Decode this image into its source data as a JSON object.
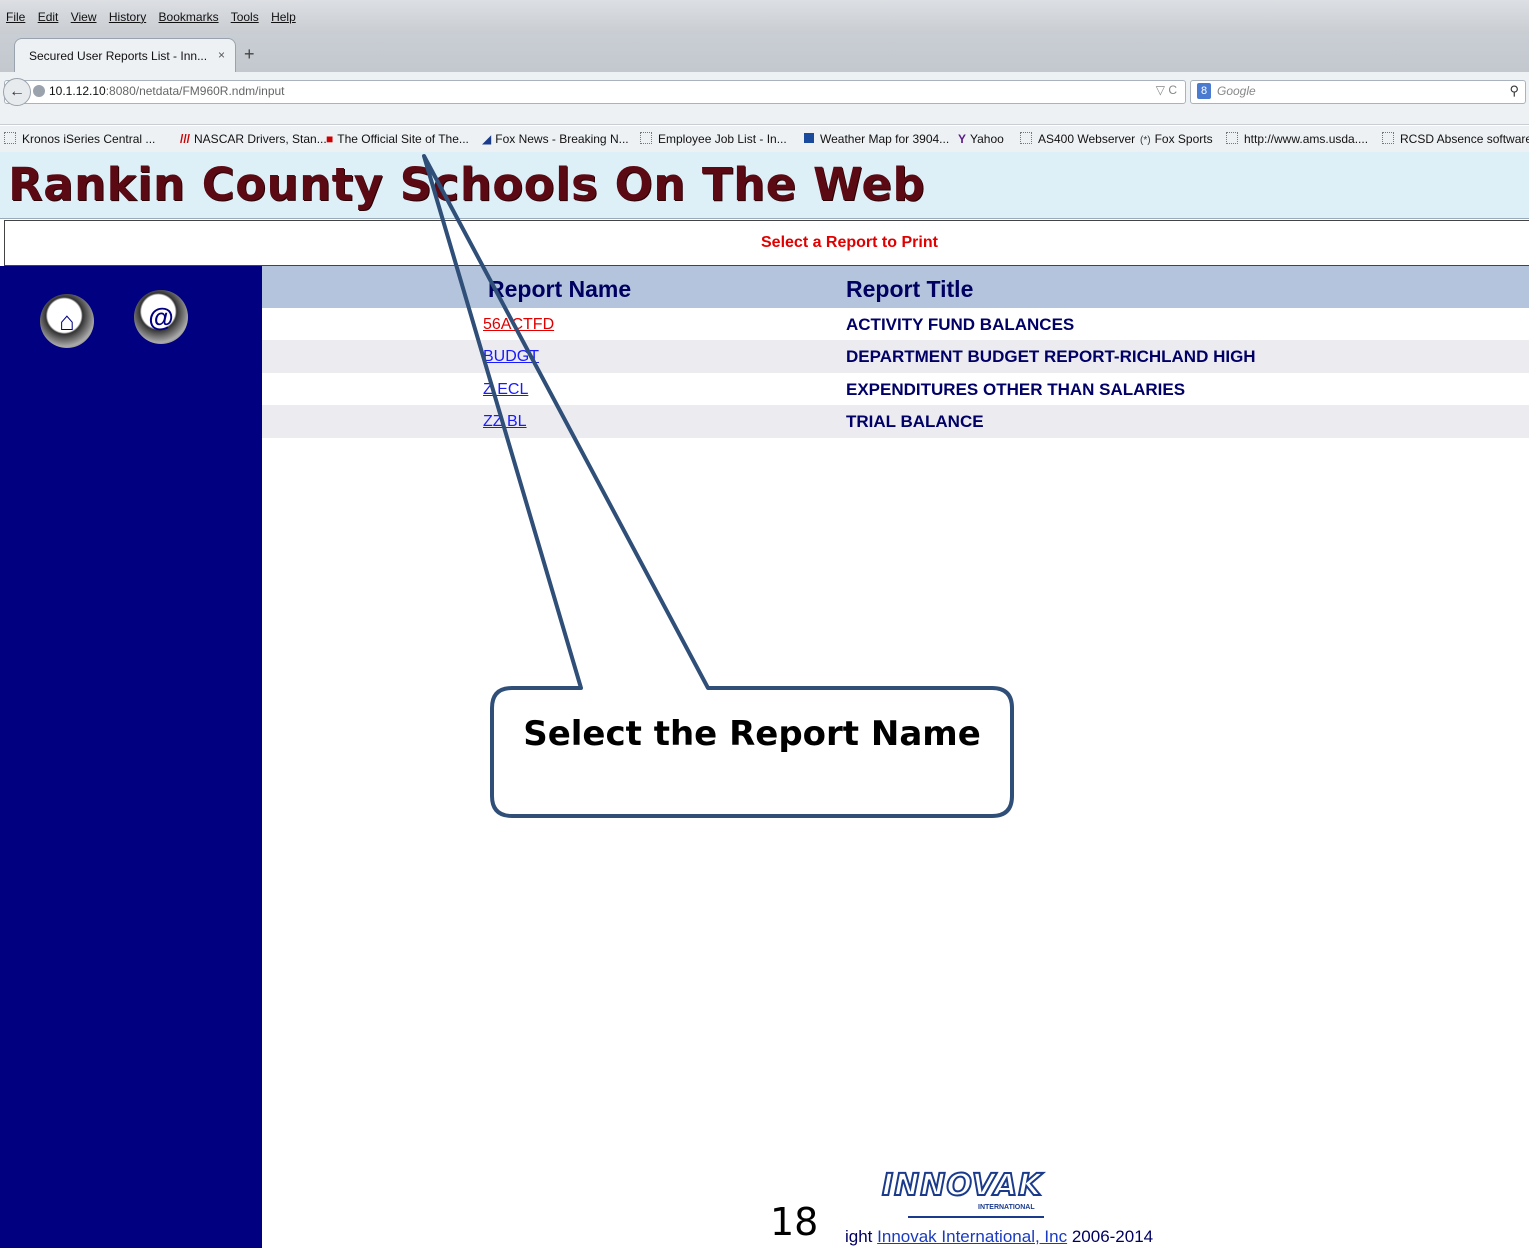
{
  "browser": {
    "menu": [
      "File",
      "Edit",
      "View",
      "History",
      "Bookmarks",
      "Tools",
      "Help"
    ],
    "tab_title": "Secured User Reports List - Inn...",
    "tab_close": "×",
    "new_tab": "+",
    "url_host": "10.1.12.10",
    "url_rest": ":8080/netdata/FM960R.ndm/input",
    "url_icons": "▽ C",
    "search_placeholder": "Google",
    "bookmarks": [
      "Kronos iSeries Central ...",
      "NASCAR Drivers, Stan...",
      "The Official Site of The...",
      "Fox News - Breaking N...",
      "Employee Job List - In...",
      "Weather Map for 3904...",
      "Yahoo",
      "AS400 Webserver",
      "Fox Sports",
      "http://www.ams.usda....",
      "RCSD Absence software"
    ]
  },
  "page": {
    "banner_title": "Rankin County Schools On The Web",
    "subheader": "Select a Report to Print",
    "sidebar": {
      "home_symbol": "⌂",
      "email_symbol": "@"
    },
    "table": {
      "headers": {
        "name": "Report Name",
        "title": "Report Title"
      },
      "rows": [
        {
          "name": "56ACTFD",
          "title": "ACTIVITY FUND BALANCES",
          "color": "#e00000"
        },
        {
          "name": "BUDGT",
          "title": "DEPARTMENT BUDGET REPORT-RICHLAND HIGH",
          "color": "#1a1aff"
        },
        {
          "name": "Z      ECL",
          "title": "EXPENDITURES OTHER THAN SALARIES",
          "color": "#1a1aff"
        },
        {
          "name": "ZZ         BL",
          "title": "TRIAL BALANCE",
          "color": "#1a1aff"
        }
      ]
    },
    "callout": "Select the Report Name",
    "footer": {
      "logo": "INNOVAK",
      "logo_sub": "INTERNATIONAL",
      "page_number": "18",
      "copyright_prefix": "ight ",
      "copyright_link": "Innovak International, Inc",
      "copyright_suffix": " 2006-2014"
    }
  }
}
